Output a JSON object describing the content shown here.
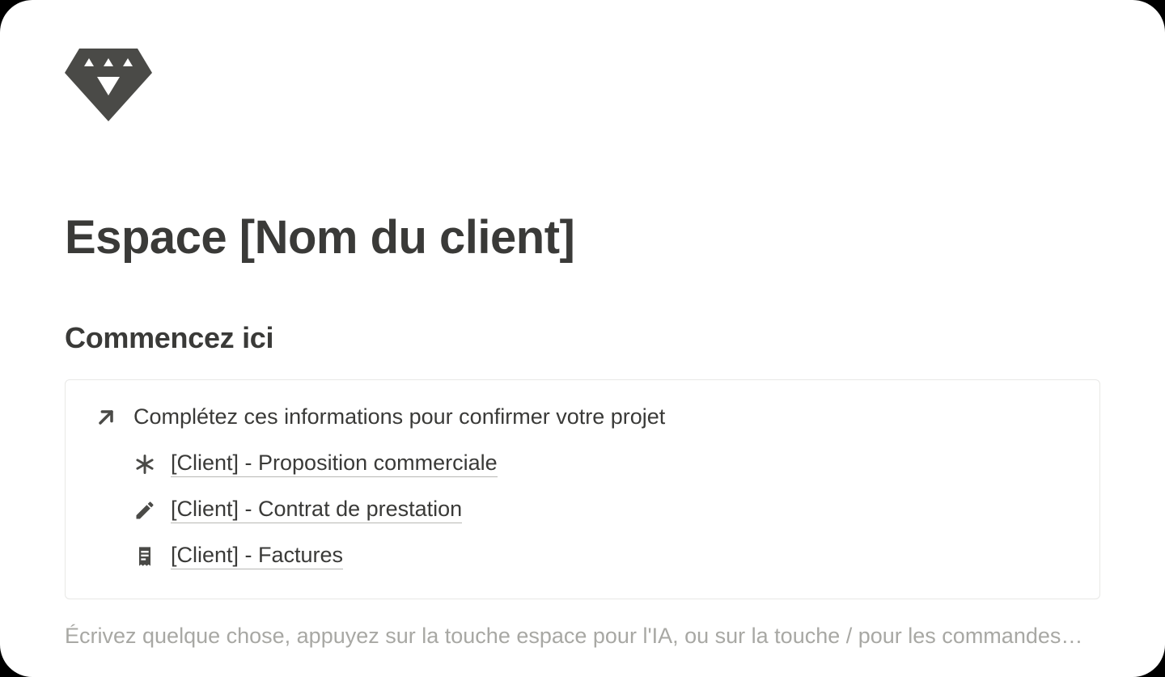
{
  "page": {
    "title": "Espace [Nom du client]"
  },
  "section": {
    "heading": "Commencez ici"
  },
  "callout": {
    "prompt": "Complétez ces informations pour confirmer votre projet",
    "links": [
      {
        "label": "[Client] - Proposition commerciale"
      },
      {
        "label": "[Client] - Contrat de prestation"
      },
      {
        "label": "[Client] - Factures"
      }
    ]
  },
  "editor": {
    "placeholder": "Écrivez quelque chose, appuyez sur la touche espace pour l'IA, ou sur la touche / pour les commandes…"
  }
}
